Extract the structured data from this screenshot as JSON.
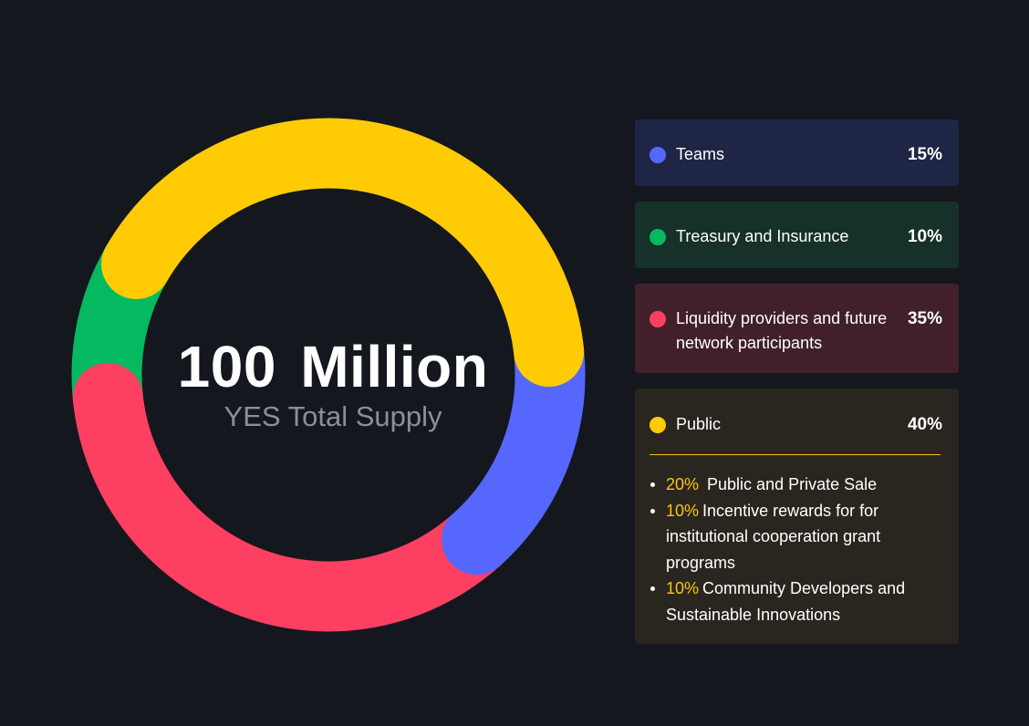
{
  "chart_data": {
    "type": "donut",
    "series": [
      {
        "name": "Public",
        "value": 40,
        "color": "#ffcb05"
      },
      {
        "name": "Teams",
        "value": 15,
        "color": "#5667fe"
      },
      {
        "name": "Liquidity providers and future network participants",
        "value": 35,
        "color": "#fd3f61"
      },
      {
        "name": "Treasury and Insurance",
        "value": 10,
        "color": "#05b961"
      }
    ]
  },
  "center": {
    "amount": "100 Million",
    "label": "YES Total Supply"
  },
  "legend": {
    "teams": {
      "label": "Teams",
      "pct": "15%",
      "dot_color": "#5667fe",
      "bg": "#1f2544"
    },
    "treasury": {
      "label": "Treasury and Insurance",
      "pct": "10%",
      "dot_color": "#05b961",
      "bg": "#16302a"
    },
    "liquidity": {
      "label": "Liquidity providers and future network participants",
      "pct": "35%",
      "dot_color": "#fd3f61",
      "bg": "#41202c"
    },
    "public": {
      "label": "Public",
      "pct": "40%",
      "dot_color": "#ffcb05",
      "bg": "#29261f",
      "items": [
        {
          "pct": "20%",
          "text": " Public and Private Sale"
        },
        {
          "pct": "10%",
          "text": "Incentive rewards for for institutional cooperation grant programs"
        },
        {
          "pct": "10%",
          "text": "Community Developers and Sustainable Innovations"
        }
      ]
    }
  }
}
